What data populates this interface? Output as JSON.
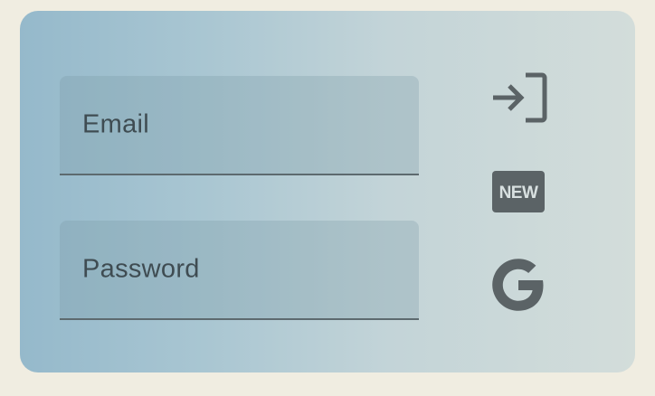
{
  "form": {
    "email": {
      "label": "Email",
      "value": ""
    },
    "password": {
      "label": "Password",
      "value": ""
    }
  },
  "actions": [
    {
      "name": "login-icon",
      "icon": "login-arrow-bracket"
    },
    {
      "name": "new-badge-icon",
      "icon": "new-badge",
      "text": "NEW"
    },
    {
      "name": "google-icon",
      "icon": "google-g"
    }
  ],
  "colors": {
    "icon": "#5b6366",
    "label": "#3f4c52",
    "underline": "#5d6a6f",
    "page_bg": "#f0ede1"
  }
}
